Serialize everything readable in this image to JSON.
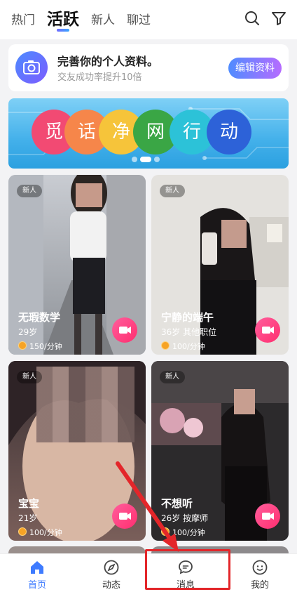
{
  "top_tabs": [
    "热门",
    "活跃",
    "新人",
    "聊过"
  ],
  "icons": {
    "search": "search-icon",
    "filter": "filter-icon"
  },
  "profile_prompt": {
    "title": "完善你的个人资料。",
    "subtitle": "交友成功率提升10倍",
    "button": "编辑资料"
  },
  "banner": {
    "chars": [
      "觅",
      "话",
      "净",
      "网",
      "行",
      "动"
    ],
    "colors": [
      "#f24a73",
      "#f6864a",
      "#f6c43a",
      "#3aa645",
      "#2cc2d8",
      "#2d62d8"
    ]
  },
  "cards": [
    {
      "tag": "新人",
      "name": "无瑕数学",
      "info": "29岁",
      "price": "150/分钟"
    },
    {
      "tag": "新人",
      "name": "宁静的端午",
      "info": "36岁  其他职位",
      "price": "100/分钟"
    },
    {
      "tag": "新人",
      "name": "宝宝",
      "info": "21岁",
      "price": "100/分钟"
    },
    {
      "tag": "新人",
      "name": "不想听",
      "info": "26岁  按摩师",
      "price": "100/分钟"
    }
  ],
  "bottom_nav": [
    "首页",
    "动态",
    "消息",
    "我的"
  ],
  "accent": "#3e7bff",
  "annotation_color": "#e3262a"
}
